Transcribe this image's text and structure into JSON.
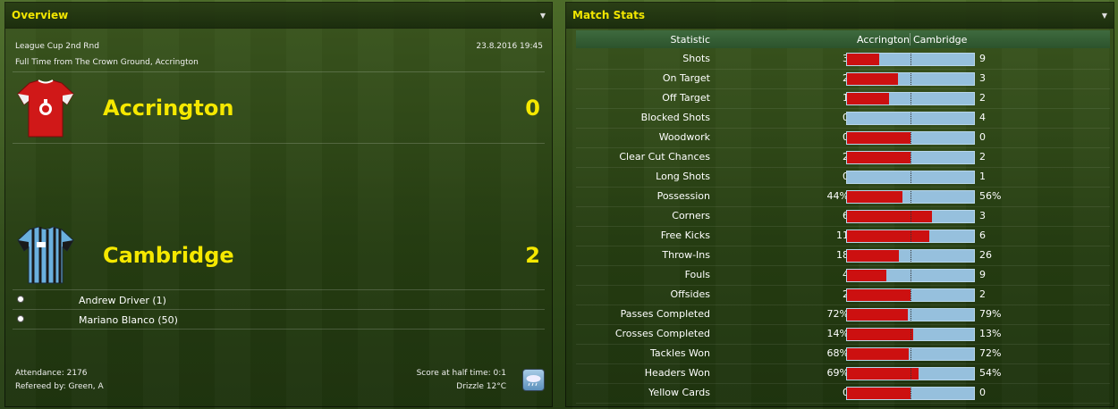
{
  "overview": {
    "title": "Overview",
    "competition": "League Cup 2nd Rnd",
    "datetime": "23.8.2016 19:45",
    "venue": "Full Time from The Crown Ground, Accrington",
    "home": {
      "name": "Accrington",
      "score": "0"
    },
    "away": {
      "name": "Cambridge",
      "score": "2"
    },
    "scorers": [
      "Andrew Driver (1)",
      "Mariano Blanco (50)"
    ],
    "attendance": "Attendance: 2176",
    "referee": "Refereed by: Green, A",
    "halftime": "Score at half time: 0:1",
    "weather": "Drizzle 12°C",
    "weather_icon": "rain-cloud-icon"
  },
  "stats": {
    "title": "Match Stats",
    "header": {
      "statistic": "Statistic",
      "home": "Accrington",
      "away": "Cambridge"
    },
    "colors": {
      "home": "#cc1010",
      "away": "#96c0dd"
    },
    "rows": [
      {
        "label": "Shots",
        "home": "3",
        "away": "9",
        "share": 0.25
      },
      {
        "label": "On Target",
        "home": "2",
        "away": "3",
        "share": 0.4
      },
      {
        "label": "Off Target",
        "home": "1",
        "away": "2",
        "share": 0.333
      },
      {
        "label": "Blocked Shots",
        "home": "0",
        "away": "4",
        "share": 0
      },
      {
        "label": "Woodwork",
        "home": "0",
        "away": "0",
        "share": 0.5
      },
      {
        "label": "Clear Cut Chances",
        "home": "2",
        "away": "2",
        "share": 0.5
      },
      {
        "label": "Long Shots",
        "home": "0",
        "away": "1",
        "share": 0
      },
      {
        "label": "Possession",
        "home": "44%",
        "away": "56%",
        "share": 0.44
      },
      {
        "label": "Corners",
        "home": "6",
        "away": "3",
        "share": 0.667
      },
      {
        "label": "Free Kicks",
        "home": "11",
        "away": "6",
        "share": 0.647
      },
      {
        "label": "Throw-Ins",
        "home": "18",
        "away": "26",
        "share": 0.409
      },
      {
        "label": "Fouls",
        "home": "4",
        "away": "9",
        "share": 0.308
      },
      {
        "label": "Offsides",
        "home": "2",
        "away": "2",
        "share": 0.5
      },
      {
        "label": "Passes Completed",
        "home": "72%",
        "away": "79%",
        "share": 0.477
      },
      {
        "label": "Crosses Completed",
        "home": "14%",
        "away": "13%",
        "share": 0.519
      },
      {
        "label": "Tackles Won",
        "home": "68%",
        "away": "72%",
        "share": 0.486
      },
      {
        "label": "Headers Won",
        "home": "69%",
        "away": "54%",
        "share": 0.561
      },
      {
        "label": "Yellow Cards",
        "home": "0",
        "away": "0",
        "share": 0.5
      }
    ]
  }
}
